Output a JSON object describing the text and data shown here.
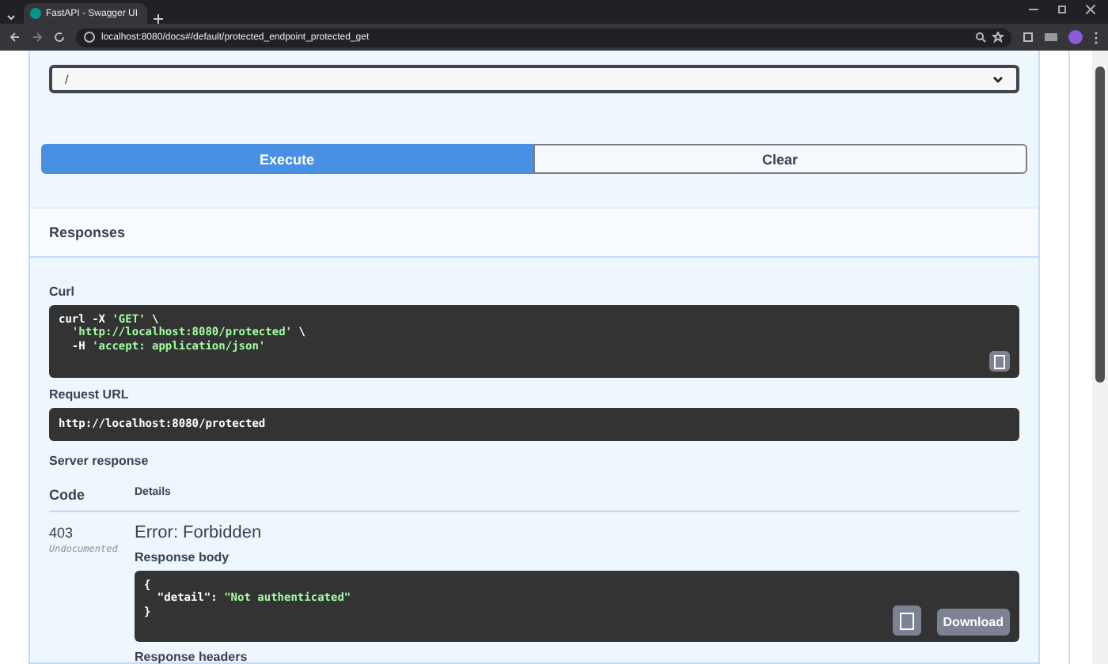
{
  "browser": {
    "tab_title": "FastAPI - Swagger UI",
    "url": "localhost:8080/docs#/default/protected_endpoint_protected_get"
  },
  "parameter_select": {
    "value": "/"
  },
  "buttons": [
    {
      "label": "Execute",
      "kind": "primary"
    },
    {
      "label": "Clear",
      "kind": "secondary"
    }
  ],
  "responses_title": "Responses",
  "curl": {
    "label": "Curl",
    "lines": [
      [
        {
          "text": "curl -X ",
          "kind": "plain"
        },
        {
          "text": "'GET'",
          "kind": "string"
        },
        {
          "text": " \\",
          "kind": "plain"
        }
      ],
      [
        {
          "text": "  'http://localhost:8080/protected'",
          "kind": "string"
        },
        {
          "text": " \\",
          "kind": "plain"
        }
      ],
      [
        {
          "text": "  -H ",
          "kind": "plain"
        },
        {
          "text": "'accept: application/json'",
          "kind": "string"
        }
      ]
    ]
  },
  "request_url": {
    "label": "Request URL",
    "value": "http://localhost:8080/protected"
  },
  "server_response": {
    "label": "Server response",
    "columns": [
      "Code",
      "Details"
    ],
    "code": "403",
    "code_note": "Undocumented",
    "error": "Error: Forbidden",
    "body_label": "Response body",
    "body_lines": [
      [
        {
          "text": "{",
          "kind": "plain"
        }
      ],
      [
        {
          "text": "  \"detail\": ",
          "kind": "plain"
        },
        {
          "text": "\"Not authenticated\"",
          "kind": "string"
        }
      ],
      [
        {
          "text": "}",
          "kind": "plain"
        }
      ]
    ],
    "download": "Download",
    "headers_label": "Response headers"
  }
}
